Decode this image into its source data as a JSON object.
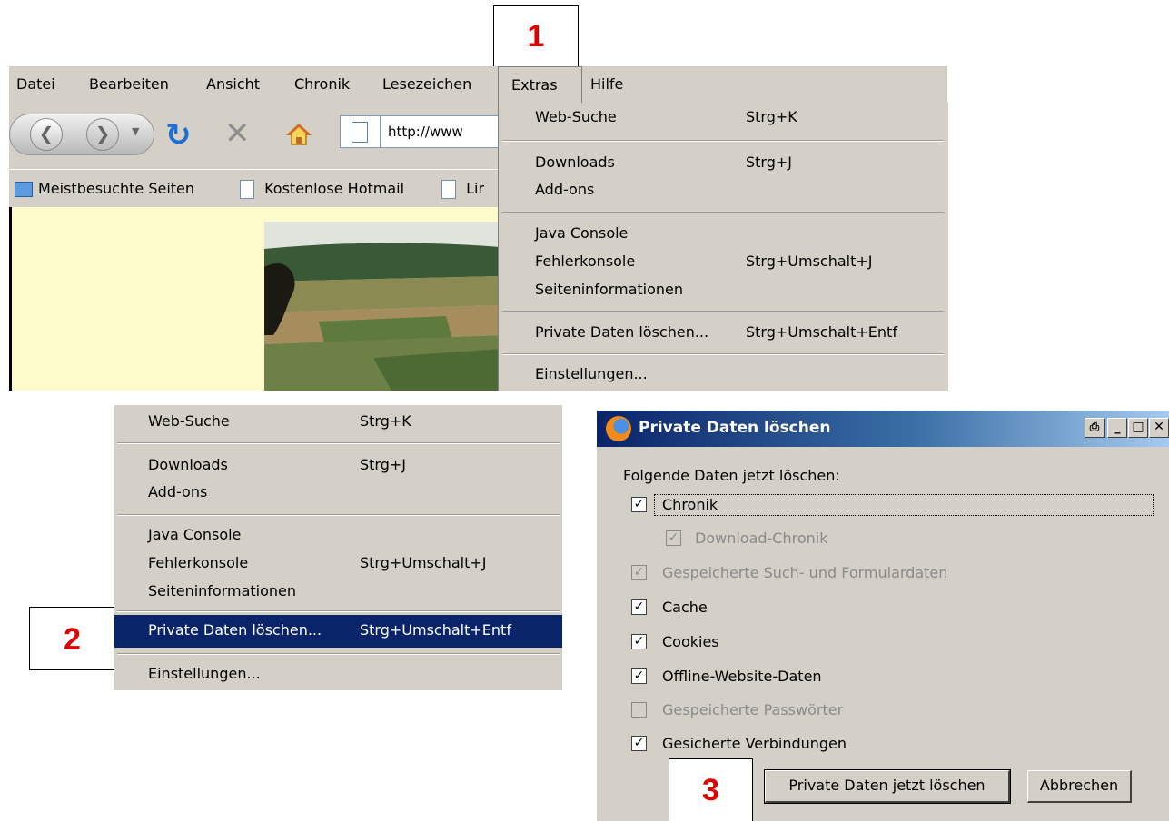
{
  "menubar": {
    "items": [
      "Datei",
      "Bearbeiten",
      "Ansicht",
      "Chronik",
      "Lesezeichen",
      "Extras",
      "Hilfe"
    ]
  },
  "navbar": {
    "url": "http://www"
  },
  "bookmarks": {
    "items": [
      "Meistbesuchte Seiten",
      "Kostenlose Hotmail",
      "Lir"
    ]
  },
  "extras_menu": {
    "web_search": "Web-Suche",
    "web_search_shortcut": "Strg+K",
    "downloads": "Downloads",
    "downloads_shortcut": "Strg+J",
    "addons": "Add-ons",
    "java_console": "Java Console",
    "error_console": "Fehlerkonsole",
    "error_console_shortcut": "Strg+Umschalt+J",
    "page_info": "Seiteninformationen",
    "clear_private": "Private Daten löschen...",
    "clear_private_shortcut": "Strg+Umschalt+Entf",
    "settings": "Einstellungen..."
  },
  "callouts": {
    "step1": "1",
    "step2": "2",
    "step3": "3"
  },
  "dialog": {
    "title": "Private Daten löschen",
    "label": "Folgende Daten jetzt löschen:",
    "options": [
      {
        "label": "Chronik",
        "checked": true,
        "disabled": false
      },
      {
        "label": "Download-Chronik",
        "checked": true,
        "disabled": true
      },
      {
        "label": "Gespeicherte Such- und Formulardaten",
        "checked": true,
        "disabled": true
      },
      {
        "label": "Cache",
        "checked": true,
        "disabled": false
      },
      {
        "label": "Cookies",
        "checked": true,
        "disabled": false
      },
      {
        "label": "Offline-Website-Daten",
        "checked": true,
        "disabled": false
      },
      {
        "label": "Gespeicherte Passwörter",
        "checked": false,
        "disabled": true
      },
      {
        "label": "Gesicherte Verbindungen",
        "checked": true,
        "disabled": false
      }
    ],
    "ok_button": "Private Daten jetzt löschen",
    "cancel_button": "Abbrechen"
  },
  "colors": {
    "menu_bg": "#d4d0c8",
    "highlight": "#0a246a",
    "callout_text": "#e00000",
    "content_bg": "#fdfacc"
  }
}
